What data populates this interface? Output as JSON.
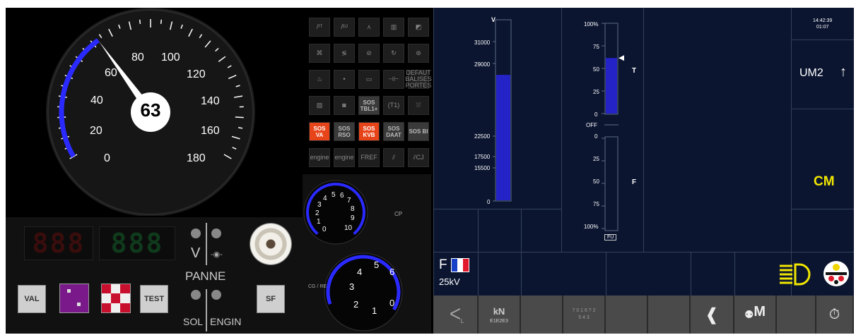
{
  "speedometer": {
    "current_speed": "63",
    "scale_labels": [
      "0",
      "20",
      "40",
      "60",
      "80",
      "100",
      "120",
      "140",
      "160",
      "180"
    ],
    "needle_speed": 63,
    "arc_color": "#2a2aff"
  },
  "displays": {
    "red_display": "888",
    "green_display": "888",
    "switch_label_v": "V",
    "panne_label": "PANNE",
    "sol_label": "SOL",
    "engin_label": "ENGIN"
  },
  "buttons": {
    "val": "VAL",
    "test": "TEST",
    "sf": "SF"
  },
  "icon_grid": {
    "row1": [
      "/ᶠᵀ",
      "/ᴰᴶ",
      "⋏",
      "▥",
      "◩"
    ],
    "row2": [
      "⌘",
      "≶",
      "⊘",
      "↻",
      "⊚"
    ],
    "row3": [
      "♨",
      "•",
      "▭",
      "⊣⊢",
      "DEFAUT BALISES PORTES"
    ],
    "row4": [
      "▨",
      "◙",
      "SOS TBL1+",
      "(T1)",
      "⛆"
    ],
    "row5": [
      "SOS VA",
      "SOS RSO",
      "SOS KVB",
      "SOS DAAT",
      "SOS BI"
    ],
    "row6": [
      "engine",
      "engine",
      "FREF",
      "⫽",
      "⫽CJ"
    ]
  },
  "pressure": {
    "cp_label": "CP",
    "cp_ticks": [
      "0",
      "1",
      "2",
      "3",
      "4",
      "5",
      "6",
      "7",
      "8",
      "9",
      "10"
    ],
    "cg_label": "CG / RE",
    "cg_ticks": [
      "0",
      "1",
      "2",
      "3",
      "4",
      "5",
      "6"
    ]
  },
  "catenary": {
    "unit": "V",
    "ticks": [
      "31000",
      "29000",
      "22500",
      "17500",
      "15500",
      "0"
    ],
    "value_v": 22500,
    "bar_color": "#2323c8"
  },
  "traction": {
    "top_ticks": [
      "100%",
      "75",
      "50",
      "25",
      "0"
    ],
    "off_label": "OFF",
    "bottom_ticks": [
      "0",
      "25",
      "50",
      "75",
      "100%"
    ],
    "t_label": "T",
    "f_label": "F",
    "fu_label": "FU",
    "traction_value_percent": 62
  },
  "status": {
    "time": "14:42:39",
    "elapsed": "01:07",
    "um_label": "UM2",
    "mode": "CM",
    "mode_color": "#f2e600",
    "power_system_letter": "F",
    "power_system_voltage": "25kV"
  },
  "bottom_bar": {
    "btn_kn_title": "kN",
    "btn_kn_sub": "E1E2E3",
    "btn_dial": "7 0 1 6 ? 2 5 4 3",
    "btn_m": "M",
    "btn_l_label": "L"
  }
}
